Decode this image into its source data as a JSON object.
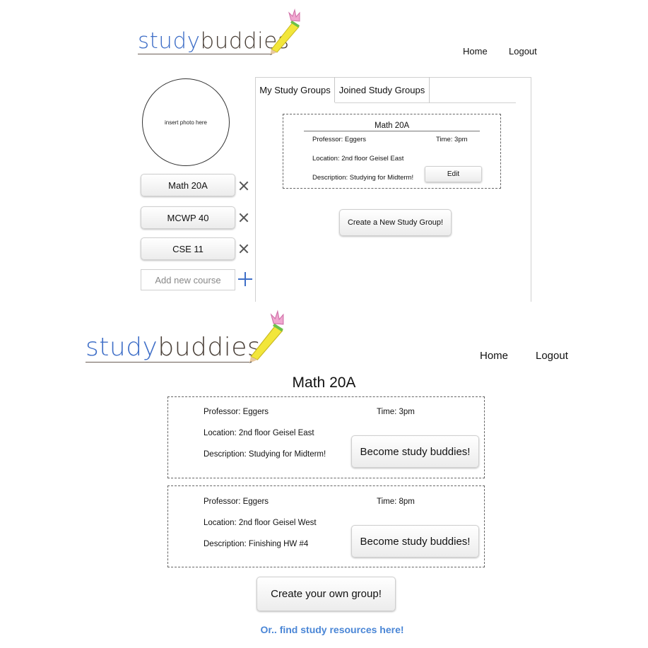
{
  "brand": {
    "logo_study": "study",
    "logo_buddies": "buddies",
    "study_color": "#3e6ec7",
    "buddies_color": "#4a4038",
    "accent_blue": "#3e6ec7",
    "link_blue": "#4a86d6"
  },
  "top": {
    "nav": {
      "home": "Home",
      "logout": "Logout"
    },
    "profile": {
      "photo_placeholder": "insert photo here"
    },
    "courses": [
      {
        "label": "Math 20A",
        "remove_icon": "close-icon"
      },
      {
        "label": "MCWP 40",
        "remove_icon": "close-icon"
      },
      {
        "label": "CSE 11",
        "remove_icon": "close-icon"
      }
    ],
    "add_course": {
      "placeholder": "Add new course",
      "add_icon": "plus-icon"
    },
    "tabs": [
      {
        "label": "My Study Groups",
        "active": true
      },
      {
        "label": "Joined Study Groups",
        "active": false
      }
    ],
    "group_card": {
      "title": "Math 20A",
      "professor": "Professor: Eggers",
      "time": "Time: 3pm",
      "location": "Location: 2nd floor Geisel East",
      "description": "Description: Studying for Midterm!",
      "edit_label": "Edit"
    },
    "create_button": "Create a New Study Group!"
  },
  "bottom": {
    "nav": {
      "home": "Home",
      "logout": "Logout"
    },
    "page_title": "Math 20A",
    "groups": [
      {
        "professor": "Professor: Eggers",
        "time": "Time: 3pm",
        "location": "Location: 2nd floor Geisel East",
        "description": "Description: Studying for Midterm!",
        "join_label": "Become study buddies!"
      },
      {
        "professor": "Professor: Eggers",
        "time": "Time: 8pm",
        "location": "Location: 2nd floor Geisel West",
        "description": "Description: Finishing HW #4",
        "join_label": "Become study buddies!"
      }
    ],
    "create_button": "Create your own group!",
    "resources_link": "Or.. find study resources here!"
  }
}
